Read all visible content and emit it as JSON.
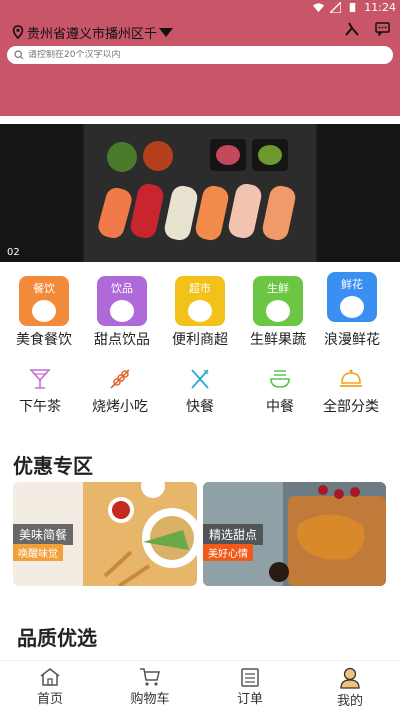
{
  "status_bar": {
    "time": "11:24"
  },
  "header": {
    "location": "贵州省遵义市播州区千",
    "search_placeholder": "请控制在20个汉字以内",
    "color": "#c85568"
  },
  "banner": {
    "index_label": "02"
  },
  "categories_row1": [
    {
      "tag": "餐饮",
      "label": "美食餐饮",
      "color": "#f28a3a"
    },
    {
      "tag": "饮品",
      "label": "甜点饮品",
      "color": "#b069d9"
    },
    {
      "tag": "超市",
      "label": "便利商超",
      "color": "#f2c21a"
    },
    {
      "tag": "生鲜",
      "label": "生鲜果蔬",
      "color": "#6cc644"
    },
    {
      "tag": "鲜花",
      "label": "浪漫鲜花",
      "color": "#3a8ff2"
    }
  ],
  "categories_row2": [
    {
      "icon": "cocktail-icon",
      "label": "下午茶"
    },
    {
      "icon": "skewer-icon",
      "label": "烧烤小吃"
    },
    {
      "icon": "utensils-icon",
      "label": "快餐"
    },
    {
      "icon": "noodle-bowl-icon",
      "label": "中餐"
    },
    {
      "icon": "covered-dish-icon",
      "label": "全部分类"
    }
  ],
  "promo": {
    "title": "优惠专区",
    "cards": [
      {
        "name": "美味简餐",
        "sub": "唤醒味觉",
        "sub_color": "#f2a03a"
      },
      {
        "name": "精选甜点",
        "sub": "美好心情",
        "sub_color": "#f25a1a"
      }
    ]
  },
  "quality": {
    "title": "品质优选"
  },
  "bottom_nav": [
    {
      "icon": "home-icon",
      "label": "首页"
    },
    {
      "icon": "cart-icon",
      "label": "购物车"
    },
    {
      "icon": "orders-icon",
      "label": "订单"
    },
    {
      "icon": "profile-icon",
      "label": "我的"
    }
  ]
}
